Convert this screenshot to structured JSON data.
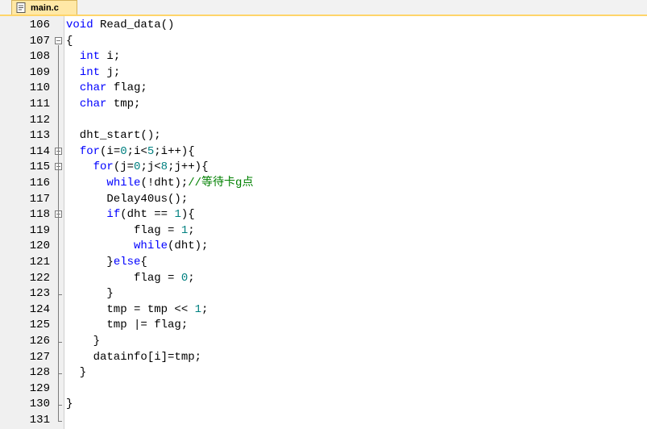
{
  "tab": {
    "filename": "main.c",
    "icon": "c-file-icon"
  },
  "code_lines": [
    {
      "num": "106",
      "tokens": [
        {
          "t": "kw",
          "s": "void"
        },
        {
          "t": "pl",
          "s": " Read_data()"
        }
      ]
    },
    {
      "num": "107",
      "tokens": [
        {
          "t": "pl",
          "s": "{"
        }
      ]
    },
    {
      "num": "108",
      "tokens": [
        {
          "t": "pl",
          "s": "  "
        },
        {
          "t": "kw",
          "s": "int"
        },
        {
          "t": "pl",
          "s": " i;"
        }
      ]
    },
    {
      "num": "109",
      "tokens": [
        {
          "t": "pl",
          "s": "  "
        },
        {
          "t": "kw",
          "s": "int"
        },
        {
          "t": "pl",
          "s": " j;"
        }
      ]
    },
    {
      "num": "110",
      "tokens": [
        {
          "t": "pl",
          "s": "  "
        },
        {
          "t": "kw",
          "s": "char"
        },
        {
          "t": "pl",
          "s": " flag;"
        }
      ]
    },
    {
      "num": "111",
      "tokens": [
        {
          "t": "pl",
          "s": "  "
        },
        {
          "t": "kw",
          "s": "char"
        },
        {
          "t": "pl",
          "s": " tmp;"
        }
      ]
    },
    {
      "num": "112",
      "tokens": []
    },
    {
      "num": "113",
      "tokens": [
        {
          "t": "pl",
          "s": "  dht_start();"
        }
      ]
    },
    {
      "num": "114",
      "tokens": [
        {
          "t": "pl",
          "s": "  "
        },
        {
          "t": "kw",
          "s": "for"
        },
        {
          "t": "pl",
          "s": "(i="
        },
        {
          "t": "num",
          "s": "0"
        },
        {
          "t": "pl",
          "s": ";i<"
        },
        {
          "t": "num",
          "s": "5"
        },
        {
          "t": "pl",
          "s": ";i++){"
        }
      ]
    },
    {
      "num": "115",
      "tokens": [
        {
          "t": "pl",
          "s": "    "
        },
        {
          "t": "kw",
          "s": "for"
        },
        {
          "t": "pl",
          "s": "(j="
        },
        {
          "t": "num",
          "s": "0"
        },
        {
          "t": "pl",
          "s": ";j<"
        },
        {
          "t": "num",
          "s": "8"
        },
        {
          "t": "pl",
          "s": ";j++){"
        }
      ]
    },
    {
      "num": "116",
      "tokens": [
        {
          "t": "pl",
          "s": "      "
        },
        {
          "t": "kw",
          "s": "while"
        },
        {
          "t": "pl",
          "s": "(!dht);"
        },
        {
          "t": "cm",
          "s": "//等待卡g点"
        }
      ]
    },
    {
      "num": "117",
      "tokens": [
        {
          "t": "pl",
          "s": "      Delay40us();"
        }
      ]
    },
    {
      "num": "118",
      "tokens": [
        {
          "t": "pl",
          "s": "      "
        },
        {
          "t": "kw",
          "s": "if"
        },
        {
          "t": "pl",
          "s": "(dht == "
        },
        {
          "t": "num",
          "s": "1"
        },
        {
          "t": "pl",
          "s": "){"
        }
      ]
    },
    {
      "num": "119",
      "tokens": [
        {
          "t": "pl",
          "s": "          flag = "
        },
        {
          "t": "num",
          "s": "1"
        },
        {
          "t": "pl",
          "s": ";"
        }
      ]
    },
    {
      "num": "120",
      "tokens": [
        {
          "t": "pl",
          "s": "          "
        },
        {
          "t": "kw",
          "s": "while"
        },
        {
          "t": "pl",
          "s": "(dht);"
        }
      ]
    },
    {
      "num": "121",
      "tokens": [
        {
          "t": "pl",
          "s": "      }"
        },
        {
          "t": "kw",
          "s": "else"
        },
        {
          "t": "pl",
          "s": "{"
        }
      ]
    },
    {
      "num": "122",
      "tokens": [
        {
          "t": "pl",
          "s": "          flag = "
        },
        {
          "t": "num",
          "s": "0"
        },
        {
          "t": "pl",
          "s": ";"
        }
      ]
    },
    {
      "num": "123",
      "tokens": [
        {
          "t": "pl",
          "s": "      }"
        }
      ]
    },
    {
      "num": "124",
      "tokens": [
        {
          "t": "pl",
          "s": "      tmp = tmp << "
        },
        {
          "t": "num",
          "s": "1"
        },
        {
          "t": "pl",
          "s": ";"
        }
      ]
    },
    {
      "num": "125",
      "tokens": [
        {
          "t": "pl",
          "s": "      tmp |= flag;"
        }
      ]
    },
    {
      "num": "126",
      "tokens": [
        {
          "t": "pl",
          "s": "    }"
        }
      ]
    },
    {
      "num": "127",
      "tokens": [
        {
          "t": "pl",
          "s": "    datainfo[i]=tmp;"
        }
      ]
    },
    {
      "num": "128",
      "tokens": [
        {
          "t": "pl",
          "s": "  }"
        }
      ]
    },
    {
      "num": "129",
      "tokens": []
    },
    {
      "num": "130",
      "tokens": [
        {
          "t": "pl",
          "s": "}"
        }
      ]
    },
    {
      "num": "131",
      "tokens": []
    }
  ],
  "fold_markers": {
    "107": "box",
    "114": "box",
    "115": "box",
    "118": "box",
    "123": "tick",
    "126": "tick",
    "128": "tick",
    "130": "tick",
    "131": "end"
  },
  "colors": {
    "keyword": "#0000ff",
    "number": "#008080",
    "comment": "#008000",
    "tab_active": "#ffe8a6"
  }
}
